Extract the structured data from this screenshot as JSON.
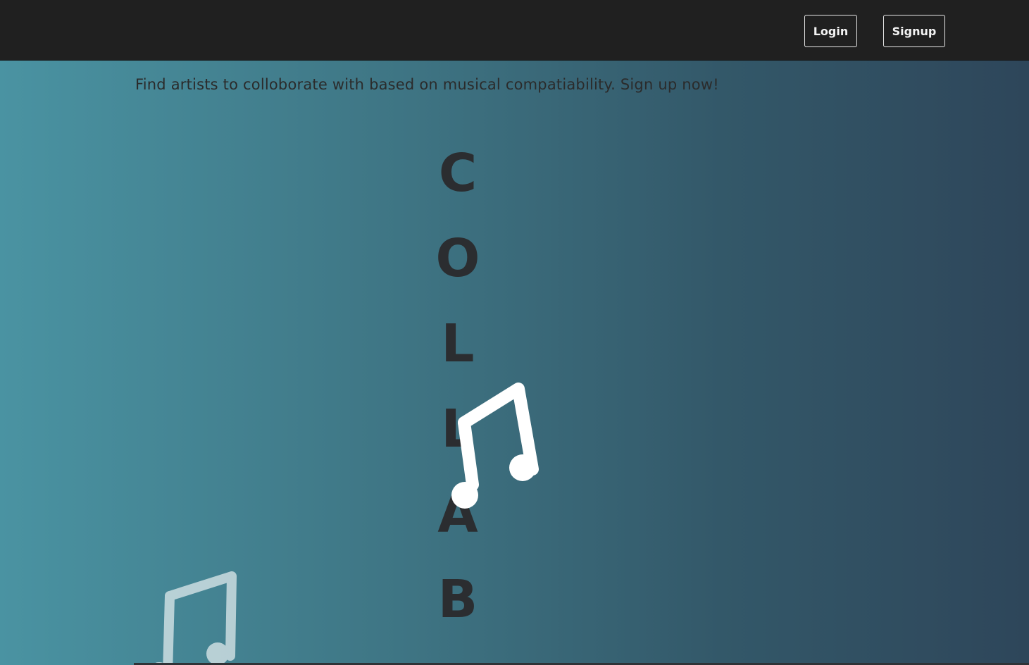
{
  "nav": {
    "login_label": "Login",
    "signup_label": "Signup"
  },
  "hero": {
    "tagline": "Find artists to colloborate with based on musical compatiability. Sign up now!",
    "letters": [
      "C",
      "O",
      "L",
      "L",
      "A",
      "B"
    ]
  },
  "icons": {
    "main_note": "music-note-icon",
    "faded_note": "music-note-icon"
  },
  "colors": {
    "navbar_bg": "#202020",
    "gradient_start": "#4a93a2",
    "gradient_end": "#2e465a",
    "text_dark": "#2b2d30",
    "note_white": "#ffffff"
  }
}
